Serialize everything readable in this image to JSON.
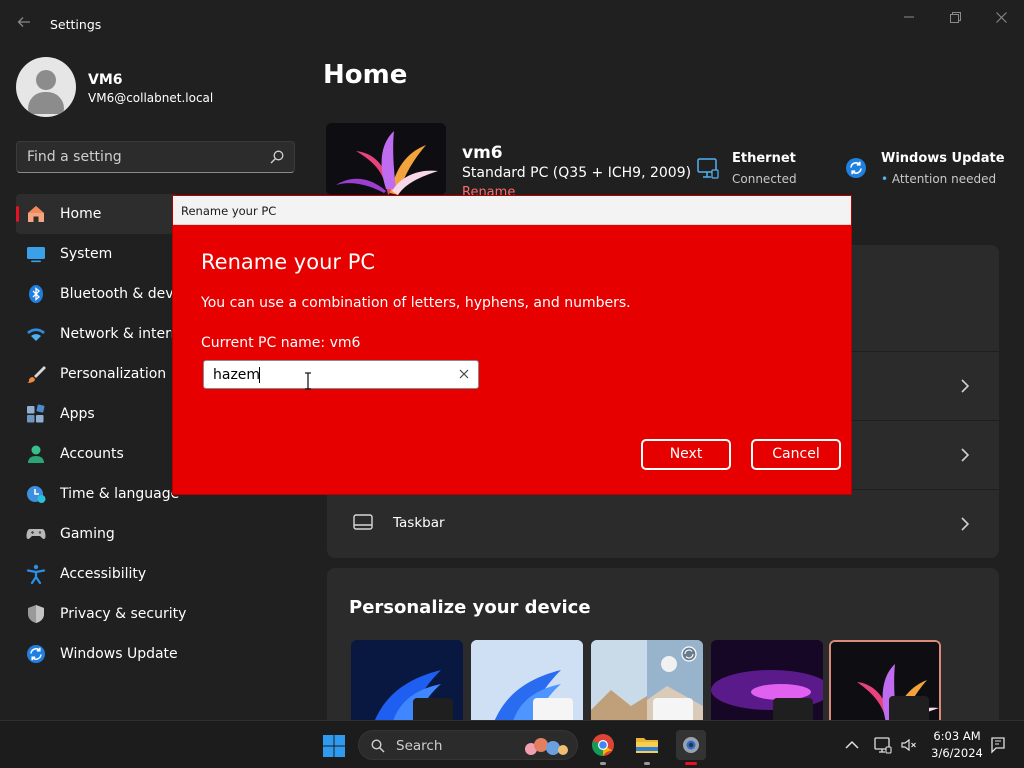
{
  "window": {
    "title": "Settings"
  },
  "profile": {
    "name": "VM6",
    "email": "VM6@collabnet.local"
  },
  "search": {
    "placeholder": "Find a setting"
  },
  "nav": {
    "items": [
      {
        "label": "Home",
        "icon": "home-icon",
        "active": true
      },
      {
        "label": "System",
        "icon": "system-icon"
      },
      {
        "label": "Bluetooth & devices",
        "icon": "bluetooth-icon"
      },
      {
        "label": "Network & internet",
        "icon": "network-icon"
      },
      {
        "label": "Personalization",
        "icon": "personalization-icon"
      },
      {
        "label": "Apps",
        "icon": "apps-icon"
      },
      {
        "label": "Accounts",
        "icon": "accounts-icon"
      },
      {
        "label": "Time & language",
        "icon": "time-language-icon"
      },
      {
        "label": "Gaming",
        "icon": "gaming-icon"
      },
      {
        "label": "Accessibility",
        "icon": "accessibility-icon"
      },
      {
        "label": "Privacy & security",
        "icon": "privacy-shield-icon"
      },
      {
        "label": "Windows Update",
        "icon": "windows-update-icon"
      }
    ]
  },
  "main": {
    "title": "Home",
    "device": {
      "name": "vm6",
      "model": "Standard PC (Q35 + ICH9, 2009)",
      "rename_link": "Rename"
    },
    "status": {
      "ethernet_title": "Ethernet",
      "ethernet_sub": "Connected",
      "update_title": "Windows Update",
      "update_sub": "Attention needed"
    },
    "recommended": {
      "taskbar_label": "Taskbar"
    },
    "personalize": {
      "title": "Personalize your device"
    }
  },
  "dialog": {
    "window_title": "Rename your PC",
    "heading": "Rename your PC",
    "description": "You can use a combination of letters, hyphens, and numbers.",
    "current_name": "Current PC name: vm6",
    "input_value": "hazem",
    "next_label": "Next",
    "cancel_label": "Cancel"
  },
  "taskbar": {
    "search_label": "Search",
    "time": "6:03 AM",
    "date": "3/6/2024"
  },
  "colors": {
    "accent": "#e81123",
    "dialog_bg": "#e60000",
    "window_bg": "#202020",
    "card_bg": "#2b2b2b"
  }
}
